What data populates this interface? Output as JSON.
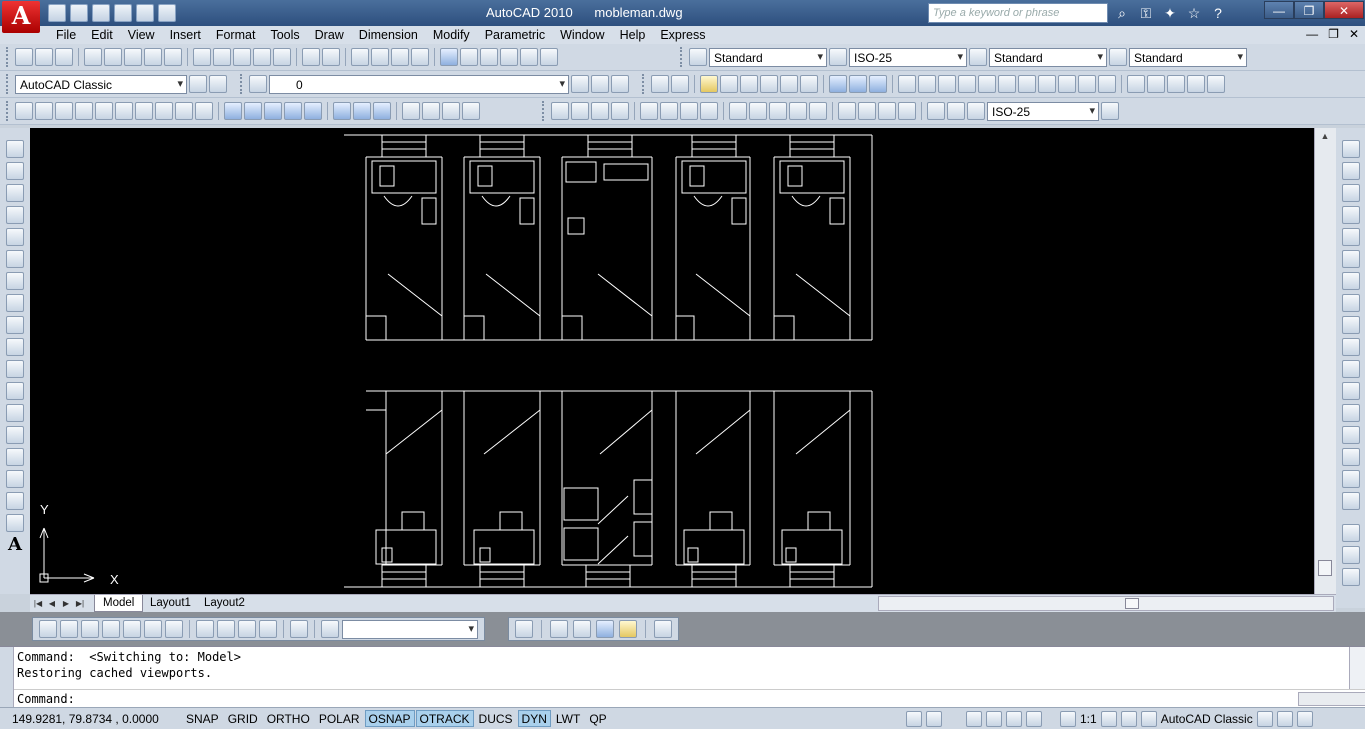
{
  "app": {
    "logo_letter": "A",
    "title": "AutoCAD 2010      mobleman.dwg",
    "search_placeholder": "Type a keyword or phrase"
  },
  "window_controls": {
    "minimize": "—",
    "restore": "❐",
    "close": "✕"
  },
  "doc_controls": {
    "minimize": "—",
    "restore": "❐",
    "close": "✕"
  },
  "menu": [
    "File",
    "Edit",
    "View",
    "Insert",
    "Format",
    "Tools",
    "Draw",
    "Dimension",
    "Modify",
    "Parametric",
    "Window",
    "Help",
    "Express"
  ],
  "styles_toolbar": {
    "text_style": "Standard",
    "dim_style": "ISO-25",
    "table_style": "Standard",
    "mleader_style": "Standard"
  },
  "workspace_toolbar": {
    "workspace": "AutoCAD Classic",
    "layer": "0"
  },
  "dim_toolbar": {
    "dim_style": "ISO-25"
  },
  "ucs": {
    "y_label": "Y",
    "x_label": "X"
  },
  "layout_tabs": [
    {
      "label": "Model",
      "active": true
    },
    {
      "label": "Layout1",
      "active": false
    },
    {
      "label": "Layout2",
      "active": false
    }
  ],
  "command_window": {
    "line1": "Command:  <Switching to: Model>",
    "line2": "Restoring cached viewports.",
    "prompt": "Command:"
  },
  "status": {
    "coordinates": "149.9281, 79.8734 , 0.0000",
    "toggles": [
      {
        "label": "SNAP",
        "on": false
      },
      {
        "label": "GRID",
        "on": false
      },
      {
        "label": "ORTHO",
        "on": false
      },
      {
        "label": "POLAR",
        "on": false
      },
      {
        "label": "OSNAP",
        "on": true
      },
      {
        "label": "OTRACK",
        "on": true
      },
      {
        "label": "DUCS",
        "on": false
      },
      {
        "label": "DYN",
        "on": true
      },
      {
        "label": "LWT",
        "on": false
      },
      {
        "label": "QP",
        "on": false
      }
    ],
    "annotation_scale": "1:1",
    "workspace": "AutoCAD Classic"
  }
}
